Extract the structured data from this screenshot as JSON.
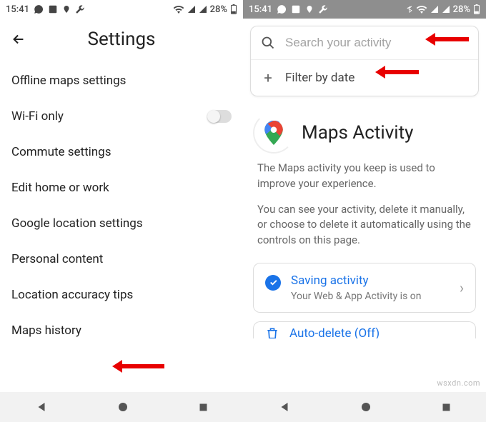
{
  "statusbar": {
    "time": "15:41",
    "battery": "28%"
  },
  "left": {
    "title": "Settings",
    "items": [
      {
        "label": "Offline maps settings"
      },
      {
        "label": "Wi-Fi only"
      },
      {
        "label": "Commute settings"
      },
      {
        "label": "Edit home or work"
      },
      {
        "label": "Google location settings"
      },
      {
        "label": "Personal content"
      },
      {
        "label": "Location accuracy tips"
      },
      {
        "label": "Maps history"
      }
    ]
  },
  "right": {
    "search_placeholder": "Search your activity",
    "filter_label": "Filter by date",
    "page_title": "Maps Activity",
    "description_1": "The Maps activity you keep is used to improve your experience.",
    "description_2": "You can see your activity, delete it manually, or choose to delete it automatically using the controls on this page.",
    "saving_card": {
      "title": "Saving activity",
      "subtitle": "Your Web & App Activity is on"
    },
    "auto_delete_card": {
      "title": "Auto-delete (Off)"
    }
  },
  "watermark": "wsxdn.com"
}
